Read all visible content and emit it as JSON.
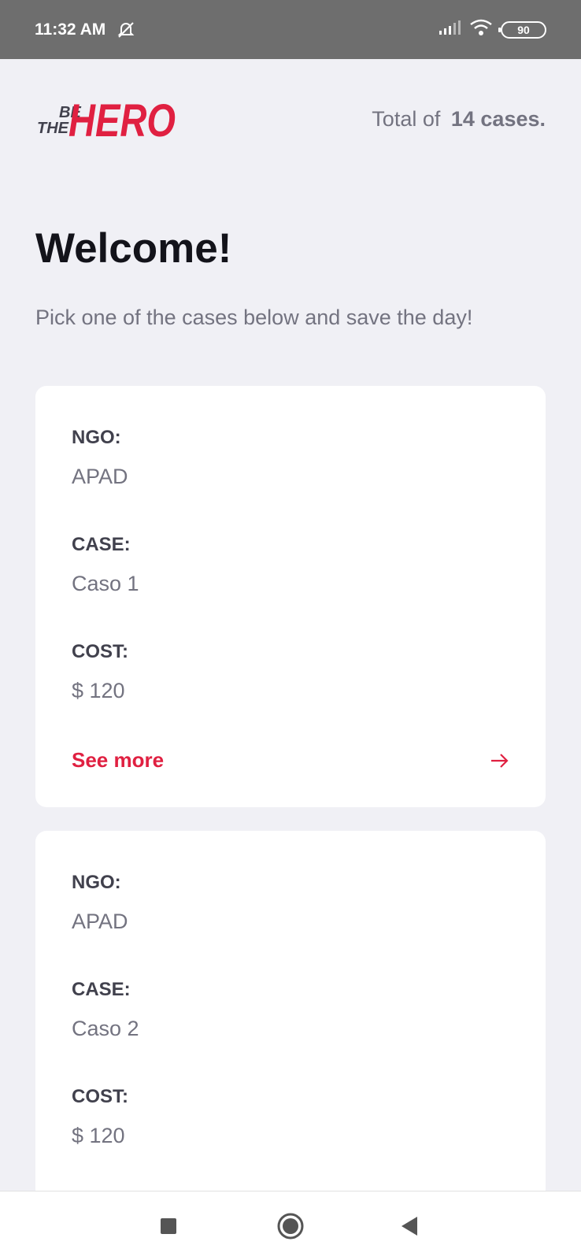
{
  "status_bar": {
    "time": "11:32 AM",
    "battery": "90",
    "icons": [
      "dnd-off-icon",
      "signal-icon",
      "wifi-icon",
      "battery-icon"
    ]
  },
  "header": {
    "logo_text": "BE THE HERO",
    "total_prefix": "Total of",
    "total_value": "14 cases."
  },
  "main": {
    "title": "Welcome!",
    "description": "Pick one of the cases below and save the day!"
  },
  "cases": [
    {
      "ngo_label": "NGO:",
      "ngo_value": "APAD",
      "case_label": "CASE:",
      "case_value": "Caso 1",
      "cost_label": "COST:",
      "cost_value": "$ 120",
      "see_more_label": "See more"
    },
    {
      "ngo_label": "NGO:",
      "ngo_value": "APAD",
      "case_label": "CASE:",
      "case_value": "Caso 2",
      "cost_label": "COST:",
      "cost_value": "$ 120"
    }
  ],
  "nav": {
    "buttons": [
      "recents-icon",
      "home-icon",
      "back-icon"
    ]
  },
  "colors": {
    "accent": "#e02041",
    "background": "#f0f0f5",
    "title": "#13131a",
    "label": "#41414d",
    "text": "#737380"
  }
}
